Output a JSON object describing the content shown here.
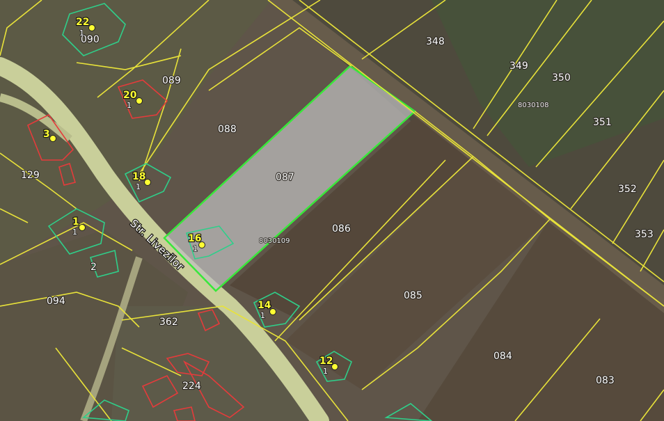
{
  "map": {
    "street_name": "Str. Livezilor",
    "sector_codes": [
      {
        "id": "sector-8030108",
        "text": "8030108"
      },
      {
        "id": "sector-8030109",
        "text": "8030109"
      }
    ],
    "parcels": [
      {
        "id": "parcel-348",
        "number": "348"
      },
      {
        "id": "parcel-349",
        "number": "349"
      },
      {
        "id": "parcel-350",
        "number": "350"
      },
      {
        "id": "parcel-351",
        "number": "351"
      },
      {
        "id": "parcel-352",
        "number": "352"
      },
      {
        "id": "parcel-353",
        "number": "353"
      },
      {
        "id": "parcel-090",
        "number": "090"
      },
      {
        "id": "parcel-089",
        "number": "089"
      },
      {
        "id": "parcel-088",
        "number": "088"
      },
      {
        "id": "parcel-087",
        "number": "087"
      },
      {
        "id": "parcel-086",
        "number": "086"
      },
      {
        "id": "parcel-085",
        "number": "085"
      },
      {
        "id": "parcel-084",
        "number": "084"
      },
      {
        "id": "parcel-083",
        "number": "083"
      },
      {
        "id": "parcel-094",
        "number": "094"
      },
      {
        "id": "parcel-129",
        "number": "129"
      },
      {
        "id": "parcel-362",
        "number": "362"
      },
      {
        "id": "parcel-224",
        "number": "224"
      },
      {
        "id": "parcel-2",
        "number": "2"
      }
    ],
    "house_numbers": [
      {
        "id": "house-22",
        "number": "22",
        "sub": "1"
      },
      {
        "id": "house-20",
        "number": "20",
        "sub": "1"
      },
      {
        "id": "house-3",
        "number": "3",
        "sub": ""
      },
      {
        "id": "house-18",
        "number": "18",
        "sub": "1"
      },
      {
        "id": "house-1",
        "number": "1",
        "sub": "1"
      },
      {
        "id": "house-16",
        "number": "16",
        "sub": "1"
      },
      {
        "id": "house-14",
        "number": "14",
        "sub": "1"
      },
      {
        "id": "house-12",
        "number": "12",
        "sub": "1"
      }
    ],
    "colors": {
      "parcel_boundary": "#e8e23a",
      "selected_parcel": "#39e83a",
      "building_registered": "#2fcf8a",
      "building_unregistered": "#e53b3b",
      "road": "#c9cf9a",
      "house_marker": "#ffff33"
    }
  }
}
